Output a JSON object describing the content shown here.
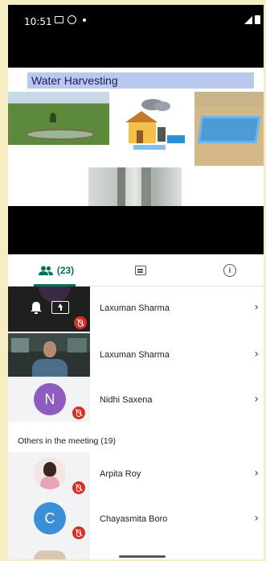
{
  "status_bar": {
    "time": "10:51"
  },
  "slide": {
    "title": "Water Harvesting"
  },
  "tabs": {
    "people_count": "(23)"
  },
  "participants": [
    {
      "name": "Laxuman Sharma"
    },
    {
      "name": "Laxuman Sharma"
    },
    {
      "name": "Nidhi Saxena",
      "initial": "N",
      "avatar_color": "#8e5bbf"
    }
  ],
  "others": {
    "heading": "Others in the meeting (19)",
    "items": [
      {
        "name": "Arpita Roy"
      },
      {
        "name": "Chayasmita Boro",
        "initial": "C",
        "avatar_color": "#3a8fd6"
      }
    ]
  },
  "colors": {
    "accent": "#0b6e5a",
    "mute_red": "#d93025",
    "frame": "#f6edc3"
  }
}
